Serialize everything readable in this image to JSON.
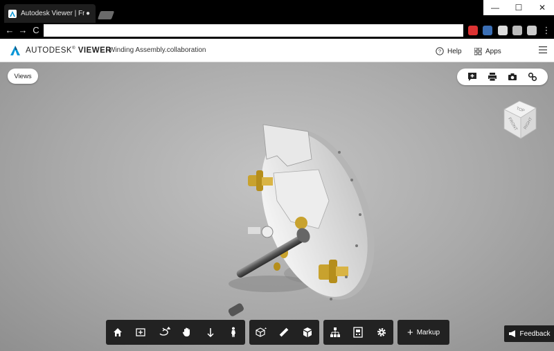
{
  "browser": {
    "tab_title": "Autodesk Viewer | Free",
    "omnibox_value": "",
    "controls": {
      "minimize": "—",
      "maximize": "☐",
      "close": "✕"
    },
    "nav": {
      "back": "←",
      "forward": "→",
      "reload": "C"
    }
  },
  "app": {
    "brand_light": "AUTODESK",
    "brand_reg": "®",
    "brand_bold": "VIEWER",
    "breadcrumb_sep": "›",
    "file_name": "Winding Assembly.collaboration",
    "help_label": "Help",
    "apps_label": "Apps"
  },
  "viewer": {
    "views_label": "Views",
    "viewcube": {
      "top": "TOP",
      "front": "FRONT",
      "right": "RIGHT"
    },
    "markup_label": "Markup",
    "feedback_label": "Feedback"
  },
  "colors": {
    "accent": "#0696d7",
    "toolbar_bg": "#222222",
    "brass": "#c8a22e"
  }
}
